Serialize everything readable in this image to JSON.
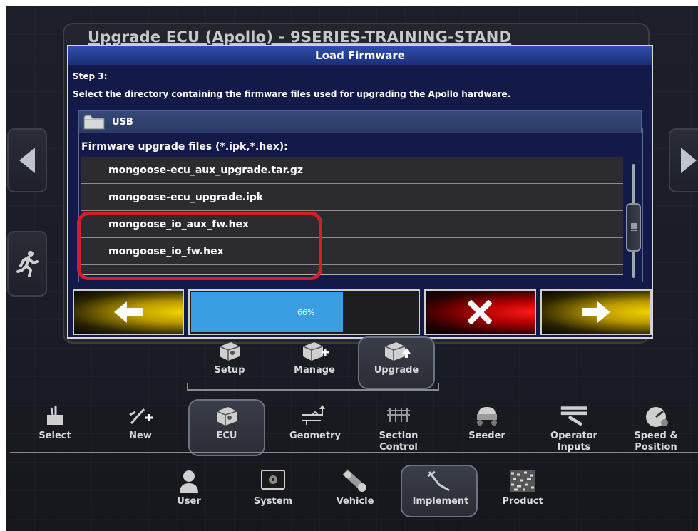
{
  "background": {
    "title": "Upgrade ECU (Apollo) - 9SERIES-TRAINING-STAND"
  },
  "modal": {
    "title": "Load Firmware",
    "step": "Step 3:",
    "instruction": "Select the directory containing the firmware files used for upgrading the Apollo hardware.",
    "directory": "USB",
    "files_label": "Firmware upgrade files (*.ipk,*.hex):",
    "files": [
      "mongoose-ecu_aux_upgrade.tar.gz",
      "mongoose-ecu_upgrade.ipk",
      "mongoose_io_aux_fw.hex",
      "mongoose_io_fw.hex"
    ],
    "progress": {
      "value": 66,
      "label": "66%"
    }
  },
  "nav": {
    "tier1": [
      "Setup",
      "Manage",
      "Upgrade"
    ],
    "tier2": [
      "Select",
      "New",
      "ECU",
      "Geometry",
      "Section Control",
      "Seeder",
      "Operator Inputs",
      "Speed & Position"
    ],
    "tier3": [
      "User",
      "System",
      "Vehicle",
      "Implement",
      "Product"
    ]
  },
  "colors": {
    "highlight": "#d2202b",
    "progress": "#3a9ee3",
    "modal_bg": "#131a4a",
    "title_bar": "#2d4fa8"
  }
}
